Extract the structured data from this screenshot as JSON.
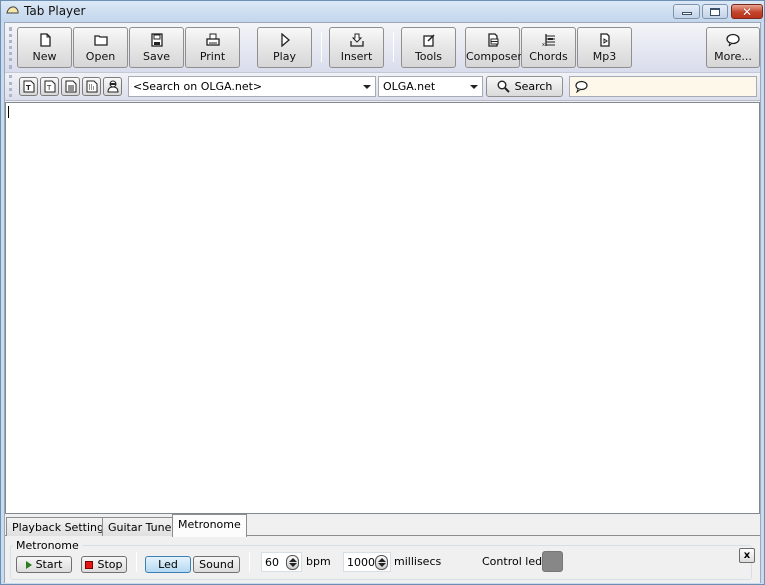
{
  "window": {
    "title": "Tab Player",
    "controls": {
      "minimize": "minimize",
      "maximize": "maximize",
      "close": "close"
    }
  },
  "toolbar": {
    "buttons": [
      {
        "label": "New",
        "icon": "new-file-icon"
      },
      {
        "label": "Open",
        "icon": "folder-icon"
      },
      {
        "label": "Save",
        "icon": "floppy-disk-icon"
      },
      {
        "label": "Print",
        "icon": "printer-icon"
      },
      {
        "label": "Play",
        "icon": "play-icon"
      },
      {
        "label": "Insert",
        "icon": "insert-icon"
      },
      {
        "label": "Tools",
        "icon": "tools-icon"
      },
      {
        "label": "Composer",
        "icon": "composer-icon"
      },
      {
        "label": "Chords",
        "icon": "chords-icon"
      },
      {
        "label": "Mp3",
        "icon": "mp3-icon"
      },
      {
        "label": "More...",
        "icon": "speech-bubble-icon"
      }
    ]
  },
  "search_bar": {
    "tool_buttons": [
      "tab-file-icon",
      "tab-file-alt-icon",
      "document-icon",
      "document-lines-icon",
      "person-icon"
    ],
    "query_value": "<Search on OLGA.net>",
    "source_value": "OLGA.net",
    "search_label": "Search",
    "chat_value": ""
  },
  "tabs": [
    {
      "label": "Playback Settings",
      "active": false
    },
    {
      "label": "Guitar Tuner",
      "active": false
    },
    {
      "label": "Metronome",
      "active": true
    }
  ],
  "metronome": {
    "group_title": "Metronome",
    "start_label": "Start",
    "stop_label": "Stop",
    "led_label": "Led",
    "sound_label": "Sound",
    "bpm_value": "60",
    "bpm_unit": "bpm",
    "ms_value": "1000",
    "ms_unit": "millisecs",
    "control_led_label": "Control led",
    "control_led_color": "#878787",
    "close_label": "x"
  }
}
